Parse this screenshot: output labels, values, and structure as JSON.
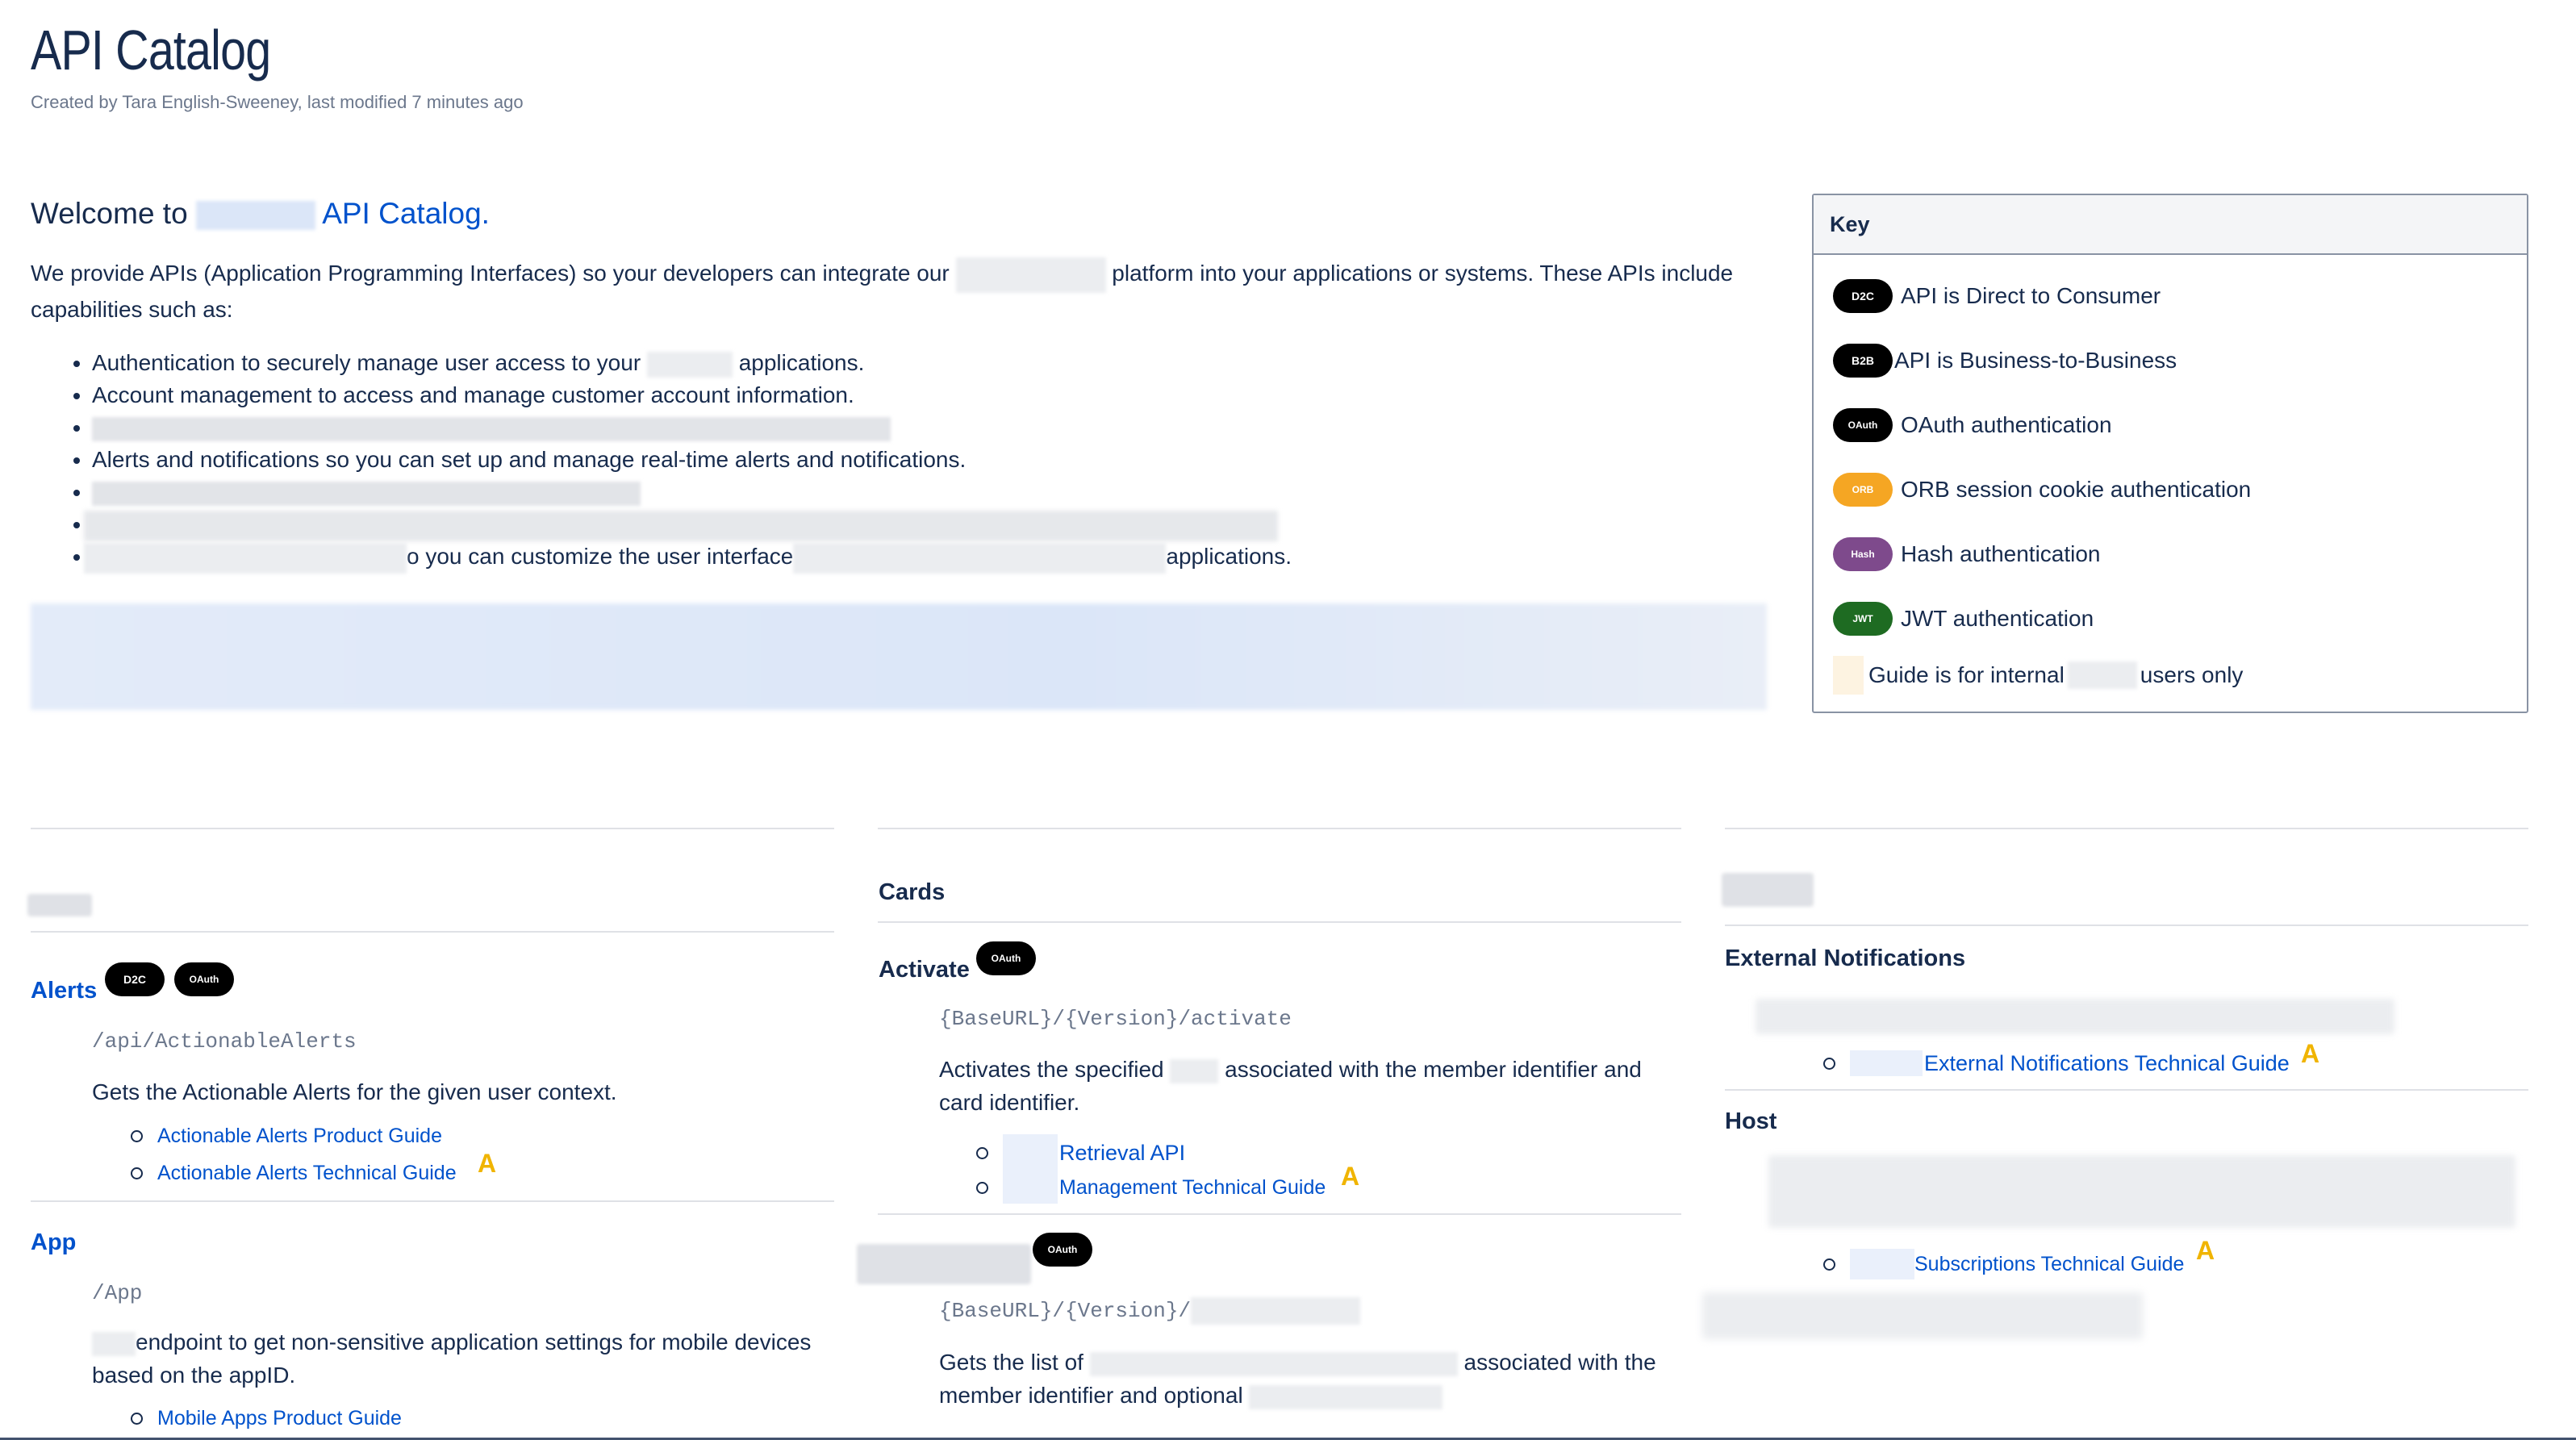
{
  "page": {
    "title": "API Catalog",
    "byline": "Created by Tara English-Sweeney, last modified 7 minutes ago"
  },
  "intro": {
    "welcome_prefix": "Welcome to",
    "welcome_link": "API Catalog.",
    "para_part1": "We provide APIs (Application Programming Interfaces) so your developers can integrate our",
    "para_part2": "platform into your applications or systems. These APIs include capabilities such as:",
    "bullets": [
      {
        "a": "Authentication to securely manage user access to your",
        "b": "applications."
      },
      {
        "a": "Account management to access and manage customer account information.",
        "b": ""
      },
      {
        "a": "",
        "b": ""
      },
      {
        "a": "Alerts and notifications so you can set up and manage real-time alerts and notifications.",
        "b": ""
      },
      {
        "a": "",
        "b": ""
      },
      {
        "a": "",
        "b": ""
      },
      {
        "a": "o you can customize the user interface",
        "b": "applications."
      }
    ]
  },
  "key": {
    "title": "Key",
    "rows": [
      {
        "badge": "D2C",
        "color": "#000000",
        "text": "API is Direct to Consumer"
      },
      {
        "badge": "B2B",
        "color": "#000000",
        "text": "API is Business-to-Business"
      },
      {
        "badge": "OAuth",
        "color": "#000000",
        "text": "OAuth authentication"
      },
      {
        "badge": "ORB",
        "color": "#f5a623",
        "text": "ORB session cookie authentication"
      },
      {
        "badge": "Hash",
        "color": "#7e4a8c",
        "text": "Hash authentication"
      },
      {
        "badge": "JWT",
        "color": "#1e6b22",
        "text": "JWT authentication"
      }
    ],
    "internal_prefix": "Guide is for internal",
    "internal_suffix": "users only"
  },
  "col1": {
    "alerts": {
      "name": "Alerts",
      "badges": [
        "D2C",
        "OAuth"
      ],
      "path": "/api/ActionableAlerts",
      "desc": "Gets the Actionable Alerts for the given user context.",
      "guides": [
        "Actionable Alerts Product Guide",
        "Actionable Alerts Technical Guide"
      ]
    },
    "app": {
      "name": "App",
      "path": "/App",
      "desc_line1": "endpoint to get non-sensitive application settings for mobile devices",
      "desc_line2": "based on the appID.",
      "guides": [
        "Mobile Apps Product Guide"
      ]
    }
  },
  "col2": {
    "section": "Cards",
    "activate": {
      "name": "Activate",
      "badge": "OAuth",
      "path": "{BaseURL}/{Version}/activate",
      "desc_a": "Activates the specified",
      "desc_b": "associated with the member identifier and",
      "desc_line2": "card identifier.",
      "guides": [
        "Retrieval API",
        "Management Technical Guide"
      ]
    },
    "second": {
      "badge": "OAuth",
      "path": "{BaseURL}/{Version}/",
      "desc_a": "Gets the list of",
      "desc_b": "associated with the",
      "desc_line2": "member identifier and optional"
    }
  },
  "col3": {
    "ext": {
      "name": "External Notifications",
      "guide": "External Notifications Technical Guide"
    },
    "host": {
      "name": "Host",
      "guide": "Subscriptions Technical Guide"
    }
  },
  "icons": {
    "internal": "A"
  }
}
